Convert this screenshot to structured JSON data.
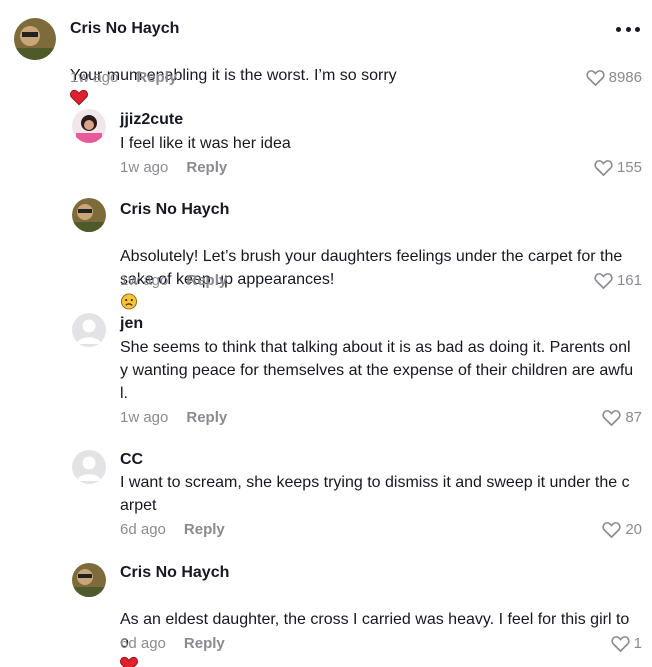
{
  "comments": [
    {
      "author": "Cris No Haych",
      "text": "Your mum enabling it is the worst. I’m so sorry",
      "emoji": "red-heart",
      "time": "1w ago",
      "reply": "Reply",
      "likes": "8986"
    },
    {
      "author": "jjiz2cute",
      "text": "I feel like it was her idea",
      "time": "1w ago",
      "reply": "Reply",
      "likes": "155"
    },
    {
      "author": "Cris No Haych",
      "text": "Absolutely! Let’s brush your daughters feelings under the carpet for the\nsake of keep up appearances!",
      "emoji": "sad-face",
      "time": "1w ago",
      "reply": "Reply",
      "likes": "161"
    },
    {
      "author": "jen",
      "text": "She seems to think that talking about it is as bad as doing it. Parents onl\ny wanting peace for themselves at the expense of their children are awfu\nl.",
      "time": "1w ago",
      "reply": "Reply",
      "likes": "87"
    },
    {
      "author": "CC",
      "text": "I want to scream, she keeps trying to dismiss it and sweep it under the c\narpet",
      "time": "6d ago",
      "reply": "Reply",
      "likes": "20"
    },
    {
      "author": "Cris No Haych",
      "text": "As an eldest daughter, the cross I carried was heavy. I feel for this girl to\no",
      "emoji": "heart-and-bandage",
      "time": "6d ago",
      "reply": "Reply",
      "likes": "1"
    }
  ],
  "colors": {
    "text": "#161823",
    "muted": "#8a8b91",
    "heart_red": "#e0202e"
  },
  "icons": {
    "like": "heart-outline-icon",
    "more": "more-dots-icon"
  }
}
